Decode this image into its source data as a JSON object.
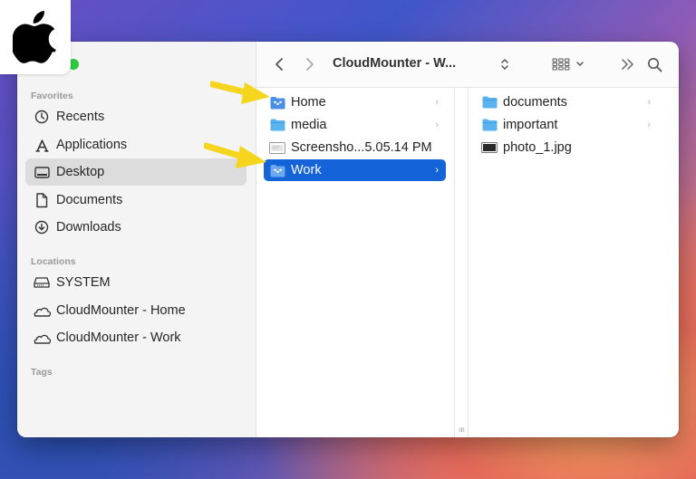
{
  "toolbar": {
    "title": "CloudMounter - W...",
    "back_icon": "chevron-left-icon",
    "forward_icon": "chevron-right-icon"
  },
  "sidebar": {
    "favorites_title": "Favorites",
    "favorites": [
      {
        "label": "Recents",
        "icon": "clock-icon"
      },
      {
        "label": "Applications",
        "icon": "applications-icon"
      },
      {
        "label": "Desktop",
        "icon": "desktop-icon",
        "selected": true
      },
      {
        "label": "Documents",
        "icon": "document-icon"
      },
      {
        "label": "Downloads",
        "icon": "download-icon"
      }
    ],
    "locations_title": "Locations",
    "locations": [
      {
        "label": "SYSTEM",
        "icon": "disk-icon"
      },
      {
        "label": "CloudMounter - Home",
        "icon": "cloud-drive-icon"
      },
      {
        "label": "CloudMounter - Work",
        "icon": "cloud-drive-icon"
      }
    ],
    "tags_title": "Tags"
  },
  "column1": [
    {
      "label": "Home",
      "icon": "dropbox-folder-icon",
      "chevron": true
    },
    {
      "label": "media",
      "icon": "folder-icon",
      "chevron": true
    },
    {
      "label": "Screensho...5.05.14 PM",
      "icon": "screenshot-file-icon",
      "chevron": false
    },
    {
      "label": "Work",
      "icon": "dropbox-folder-icon",
      "chevron": true,
      "selected": true
    }
  ],
  "column2": [
    {
      "label": "documents",
      "icon": "folder-icon",
      "chevron": true
    },
    {
      "label": "important",
      "icon": "folder-icon",
      "chevron": true
    },
    {
      "label": "photo_1.jpg",
      "icon": "image-file-icon",
      "chevron": false
    }
  ],
  "colors": {
    "accent": "#1463d8",
    "folder": "#5ab3ef",
    "arrow": "#f6d51f",
    "traffic_green": "#2bc840"
  }
}
